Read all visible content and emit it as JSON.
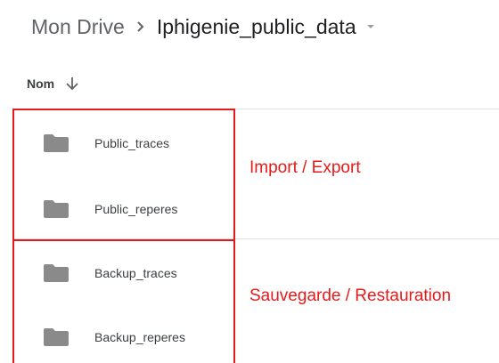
{
  "breadcrumb": {
    "root": "Mon Drive",
    "current": "Iphigenie_public_data",
    "separator_icon": "chevron-right-icon",
    "dropdown_icon": "caret-down-icon"
  },
  "list_header": {
    "name_column": "Nom",
    "sort_icon": "arrow-down-icon"
  },
  "files": [
    {
      "name": "Public_traces",
      "icon": "folder-icon"
    },
    {
      "name": "Public_reperes",
      "icon": "folder-icon"
    },
    {
      "name": "Backup_traces",
      "icon": "folder-icon"
    },
    {
      "name": "Backup_reperes",
      "icon": "folder-icon"
    }
  ],
  "annotations": {
    "import_export": "Import / Export",
    "backup_restore": "Sauvegarde / Restauration",
    "color": "#e51b1b"
  },
  "colors": {
    "folder": "#8a8a8a",
    "divider": "#e0e0e0",
    "text": "#3c4043"
  }
}
